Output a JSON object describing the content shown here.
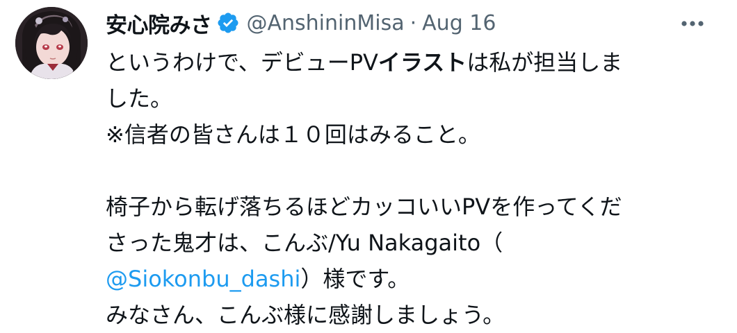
{
  "tweet": {
    "display_name": "安心院みさ",
    "handle": "@AnshininMisa",
    "separator": "·",
    "date": "Aug 16",
    "verified_icon": "verified-badge-icon",
    "more_icon": "more-options-icon",
    "body": {
      "line1_part1": "というわけで、デビューPV",
      "line1_bold": "イラスト",
      "line1_part2": "は私が担当しま",
      "line2": "した。",
      "line3": "※信者の皆さんは１０回はみること。",
      "line5": "椅子から転げ落ちるほどカッコいいPVを作ってくだ",
      "line6": "さった鬼才は、こんぶ/Yu Nakagaito（",
      "line7_mention": "@Siokonbu_dashi",
      "line7_after": "）様です。",
      "line8": "みなさん、こんぶ様に感謝しましょう。"
    }
  },
  "colors": {
    "text": "#0f1419",
    "secondary": "#536471",
    "accent": "#1d9bf0"
  }
}
